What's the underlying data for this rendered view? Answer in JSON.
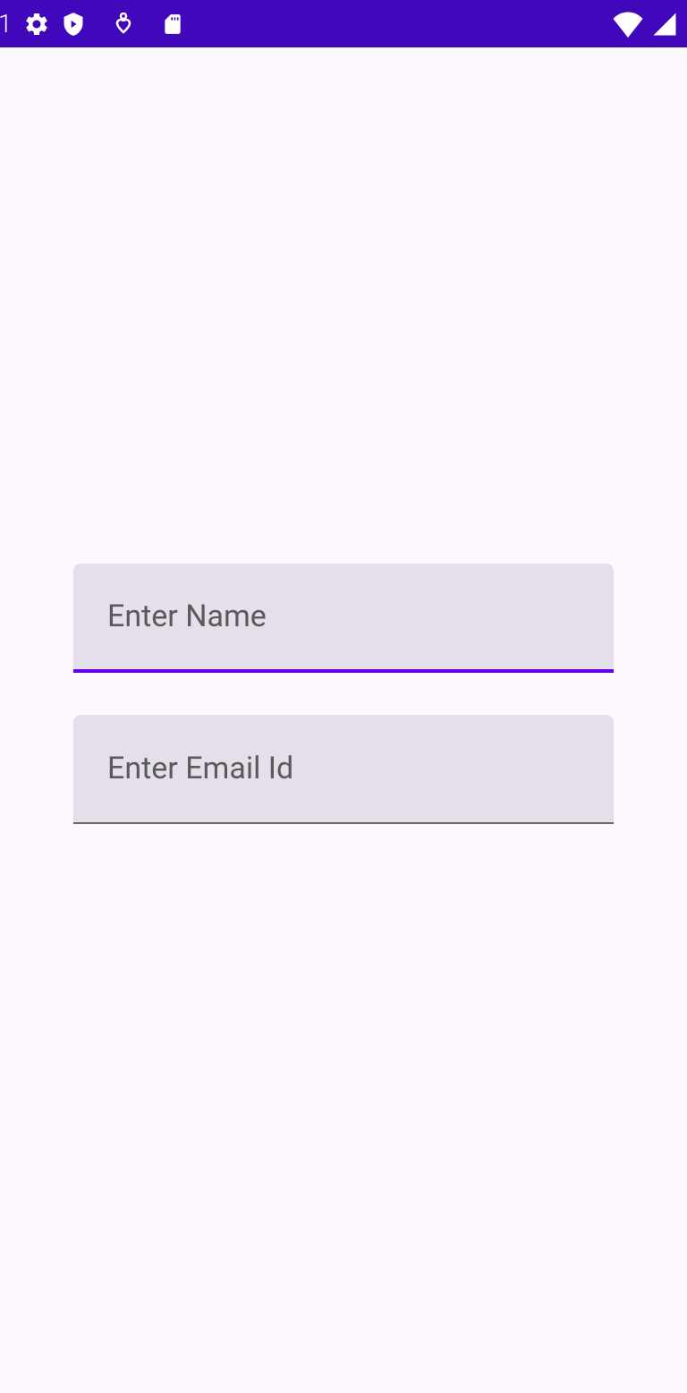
{
  "status_bar": {
    "digit": "1"
  },
  "form": {
    "name": {
      "placeholder": "Enter Name",
      "value": ""
    },
    "email": {
      "placeholder": "Enter Email Id",
      "value": ""
    }
  }
}
